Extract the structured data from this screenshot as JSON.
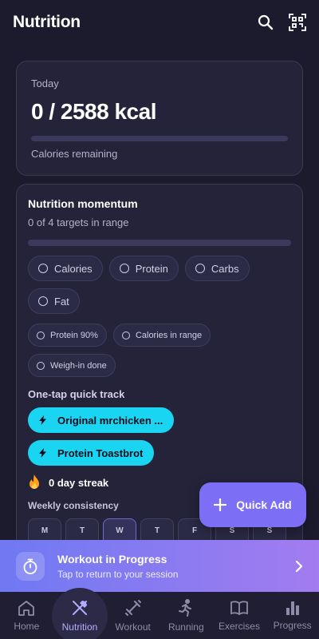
{
  "app_bar": {
    "title": "Nutrition",
    "icons": [
      "search-icon",
      "qr-scan-icon"
    ]
  },
  "today_card": {
    "label": "Today",
    "calories": "0 / 2588 kcal",
    "progress": 0,
    "footer": "Calories remaining"
  },
  "momentum": {
    "title": "Nutrition momentum",
    "subtitle": "0 of 4 targets in range",
    "progress": 0,
    "targets": [
      {
        "label": "Calories"
      },
      {
        "label": "Protein"
      },
      {
        "label": "Carbs"
      },
      {
        "label": "Fat"
      }
    ],
    "badges": [
      {
        "label": "Protein 90%"
      },
      {
        "label": "Calories in range"
      },
      {
        "label": "Weigh-in done"
      }
    ],
    "quick_track_label": "One-tap quick track",
    "quick_items": [
      {
        "label": "Original mrchicken ..."
      },
      {
        "label": "Protein Toastbrot"
      }
    ],
    "streak": "0 day streak",
    "weekly_label": "Weekly consistency",
    "days": [
      "M",
      "T",
      "W",
      "T",
      "F",
      "S",
      "S"
    ]
  },
  "fab": {
    "label": "Quick Add"
  },
  "banner": {
    "title": "Workout in Progress",
    "subtitle": "Tap to return to your session"
  },
  "nav": {
    "items": [
      {
        "label": "Home",
        "icon": "home-icon"
      },
      {
        "label": "Nutrition",
        "icon": "utensils-icon",
        "active": true
      },
      {
        "label": "Workout",
        "icon": "dumbbell-icon"
      },
      {
        "label": "Running",
        "icon": "running-icon"
      },
      {
        "label": "Exercises",
        "icon": "book-icon"
      },
      {
        "label": "Progress",
        "icon": "bar-chart-icon"
      }
    ]
  },
  "colors": {
    "background": "#1c1b2e",
    "card": "#24233a",
    "accent": "#7c6ef5",
    "quick_track": "#1ad5f2",
    "streak_flame": "#ff9f1a"
  }
}
